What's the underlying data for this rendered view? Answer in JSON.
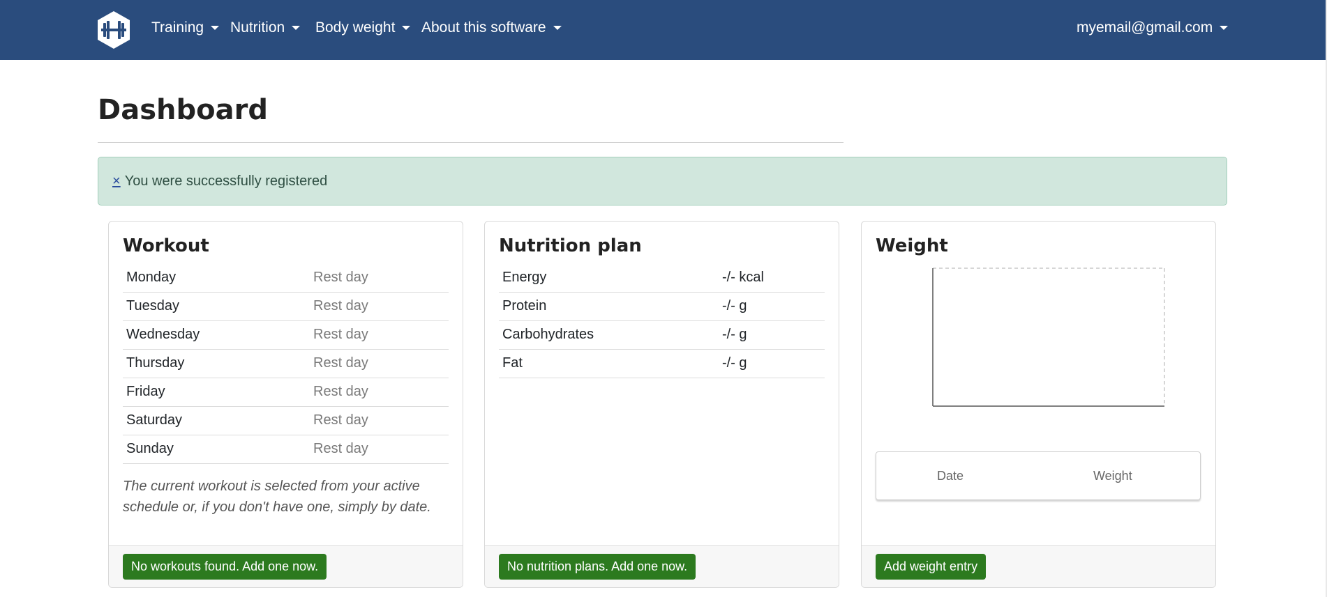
{
  "nav": {
    "items": [
      {
        "label": "Training"
      },
      {
        "label": "Nutrition"
      },
      {
        "label": "Body weight"
      },
      {
        "label": "About this software"
      }
    ],
    "user_email": "myemail@gmail.com"
  },
  "page": {
    "title": "Dashboard"
  },
  "alert": {
    "close_symbol": "×",
    "message": "You were successfully registered"
  },
  "workout": {
    "title": "Workout",
    "days": [
      {
        "day": "Monday",
        "status": "Rest day"
      },
      {
        "day": "Tuesday",
        "status": "Rest day"
      },
      {
        "day": "Wednesday",
        "status": "Rest day"
      },
      {
        "day": "Thursday",
        "status": "Rest day"
      },
      {
        "day": "Friday",
        "status": "Rest day"
      },
      {
        "day": "Saturday",
        "status": "Rest day"
      },
      {
        "day": "Sunday",
        "status": "Rest day"
      }
    ],
    "note": "The current workout is selected from your active schedule or, if you don't have one, simply by date.",
    "button_label": "No workouts found. Add one now."
  },
  "nutrition": {
    "title": "Nutrition plan",
    "rows": [
      {
        "name": "Energy",
        "value": "-/- kcal"
      },
      {
        "name": "Protein",
        "value": "-/- g"
      },
      {
        "name": "Carbohydrates",
        "value": "-/- g"
      },
      {
        "name": "Fat",
        "value": "-/- g"
      }
    ],
    "button_label": "No nutrition plans. Add one now."
  },
  "weight": {
    "title": "Weight",
    "table_headers": [
      "Date",
      "Weight"
    ],
    "button_label": "Add weight entry"
  },
  "colors": {
    "navbar": "#2a4c7d",
    "alert_bg": "#d1e7dd",
    "button_green": "#2c7a1f"
  },
  "icons": {
    "logo": "dumbbell-logo-icon",
    "dropdown": "caret-down-icon"
  }
}
